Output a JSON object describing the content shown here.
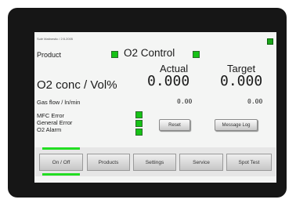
{
  "header": {
    "small_text": "Sulé Matinestic / 2:5.2005"
  },
  "product": {
    "label": "Product"
  },
  "title": "O2 Control",
  "columns": {
    "actual": "Actual",
    "target": "Target"
  },
  "o2": {
    "label": "O2 conc / Vol%",
    "actual": "0.000",
    "target": "0.000"
  },
  "gasflow": {
    "label": "Gas flow / ln/min",
    "actual": "0.00",
    "target": "0.00"
  },
  "status": {
    "mfc_error": "MFC Error",
    "general_error": "General Error",
    "o2_alarm": "O2 Alarm"
  },
  "buttons": {
    "reset": "Reset",
    "message_log": "Message Log"
  },
  "nav": {
    "on_off": "On / Off",
    "products": "Products",
    "settings": "Settings",
    "service": "Service",
    "spot_test": "Spot Test"
  },
  "colors": {
    "led_green": "#16c216",
    "nav_active_bar": "#22dd22",
    "bezel": "#161616",
    "screen": "#f4f5f4"
  }
}
